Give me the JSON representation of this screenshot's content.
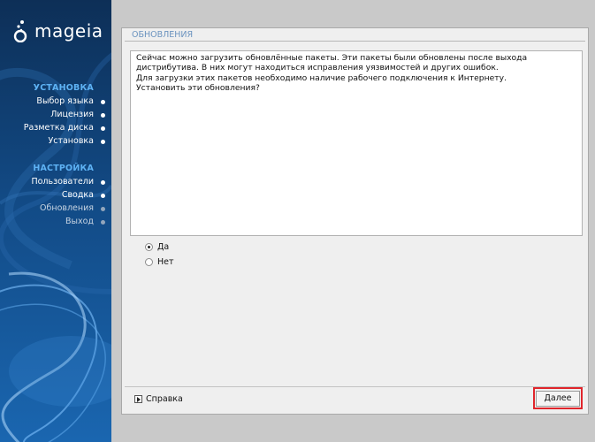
{
  "sidebar": {
    "logo_text": "mageia",
    "sections": [
      {
        "title": "УСТАНОВКА",
        "steps": [
          {
            "label": "Выбор языка",
            "state": "done"
          },
          {
            "label": "Лицензия",
            "state": "done"
          },
          {
            "label": "Разметка диска",
            "state": "done"
          },
          {
            "label": "Установка",
            "state": "done"
          }
        ]
      },
      {
        "title": "НАСТРОЙКА",
        "steps": [
          {
            "label": "Пользователи",
            "state": "done"
          },
          {
            "label": "Сводка",
            "state": "done"
          },
          {
            "label": "Обновления",
            "state": "current"
          },
          {
            "label": "Выход",
            "state": "pending"
          }
        ]
      }
    ]
  },
  "window": {
    "title": "ОБНОВЛЕНИЯ",
    "message": [
      "Сейчас можно загрузить обновлённые пакеты. Эти пакеты были обновлены после выхода дистрибутива. В них могут находиться исправления уязвимостей и других ошибок.",
      "Для загрузки этих пакетов необходимо наличие рабочего подключения к Интернету.",
      "Установить эти обновления?"
    ],
    "options": [
      {
        "label": "Да",
        "checked": true
      },
      {
        "label": "Нет",
        "checked": false
      }
    ],
    "help_label": "Справка",
    "next_label": "Далее"
  },
  "colors": {
    "sidebar_bg": "#0f3f73",
    "section_title": "#5eb2f4",
    "window_title": "#6b93bf",
    "highlight": "#e0252b"
  }
}
